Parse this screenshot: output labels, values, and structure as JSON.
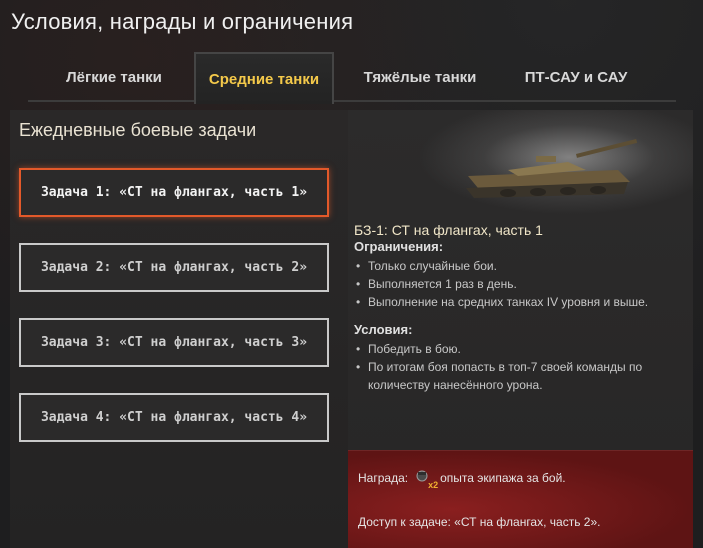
{
  "window": {
    "title": "Условия, награды и ограничения"
  },
  "tabs": [
    {
      "label": "Лёгкие танки",
      "active": false
    },
    {
      "label": "Средние танки",
      "active": true
    },
    {
      "label": "Тяжёлые танки",
      "active": false
    },
    {
      "label": "ПТ-САУ и САУ",
      "active": false
    }
  ],
  "left_panel": {
    "title": "Ежедневные боевые задачи",
    "tasks": [
      {
        "label": "Задача 1: «СТ на флангах, часть 1»",
        "selected": true
      },
      {
        "label": "Задача 2: «СТ на флангах, часть 2»",
        "selected": false
      },
      {
        "label": "Задача 3: «СТ на флангах, часть 3»",
        "selected": false
      },
      {
        "label": "Задача 4: «СТ на флангах, часть 4»",
        "selected": false
      }
    ]
  },
  "details": {
    "title": "БЗ-1: СТ на флангах, часть 1",
    "restrictions_heading": "Ограничения:",
    "restrictions": [
      "Только случайные бои.",
      "Выполняется 1 раз в день.",
      "Выполнение на средних танках IV уровня и выше."
    ],
    "conditions_heading": "Условия:",
    "conditions": [
      "Победить в бою.",
      "По итогам боя попасть в топ-7 своей команды по количеству нанесённого урона."
    ],
    "reward_label": "Награда:",
    "reward_multiplier": "x2",
    "reward_text": "опыта экипажа за бой.",
    "access_text": "Доступ к задаче: «СТ на флангах, часть 2»."
  },
  "colors": {
    "accent_tab": "#f4c94a",
    "selected_border": "#e3592a",
    "reward_bg": "#7a1c1c"
  },
  "icons": [
    "tank-image",
    "crew-icon"
  ]
}
